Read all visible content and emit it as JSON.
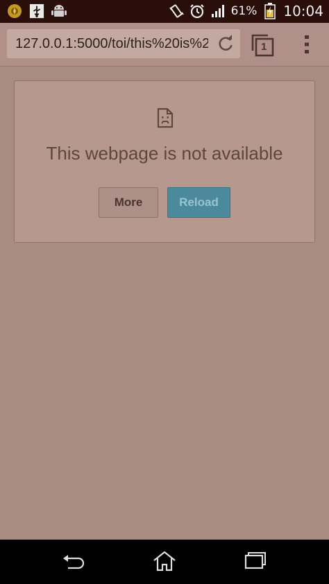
{
  "status_bar": {
    "left_icons": [
      "notification-app-icon",
      "usb-icon",
      "android-debug-icon"
    ],
    "right_icons": [
      "vibrate-icon",
      "alarm-icon",
      "signal-icon",
      "battery-charging-icon"
    ],
    "battery_percent": "61%",
    "time": "10:04"
  },
  "toolbar": {
    "url": "127.0.0.1:5000/toi/this%20is%2",
    "tab_count": "1"
  },
  "error_page": {
    "message": "This webpage is not available",
    "more_label": "More",
    "reload_label": "Reload"
  },
  "colors": {
    "page_background": "#a88c82",
    "reload_button": "#4a8a9c",
    "status_bar": "#2a0e0a"
  }
}
